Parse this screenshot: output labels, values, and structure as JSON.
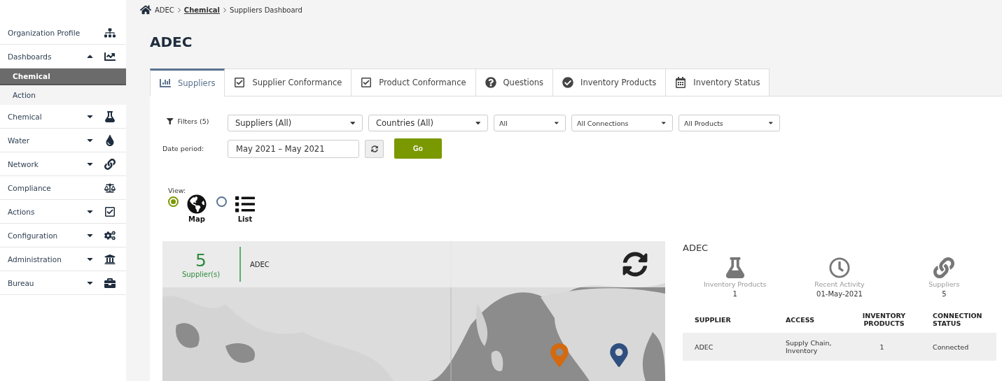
{
  "sidebar": {
    "items": [
      {
        "label": "Organization Profile",
        "kind": "link"
      },
      {
        "label": "Dashboards",
        "kind": "menu",
        "expanded": true,
        "children": [
          {
            "label": "Chemical",
            "selected": true
          },
          {
            "label": "Action",
            "selected": false
          }
        ]
      },
      {
        "label": "Chemical",
        "kind": "menu",
        "expanded": false
      },
      {
        "label": "Water",
        "kind": "menu",
        "expanded": false
      },
      {
        "label": "Network",
        "kind": "menu",
        "expanded": false
      },
      {
        "label": "Compliance",
        "kind": "link"
      },
      {
        "label": "Actions",
        "kind": "menu",
        "expanded": false
      },
      {
        "label": "Configuration",
        "kind": "menu",
        "expanded": false
      },
      {
        "label": "Administration",
        "kind": "menu",
        "expanded": false
      },
      {
        "label": "Bureau",
        "kind": "menu",
        "expanded": false
      }
    ]
  },
  "breadcrumb": [
    {
      "label": "ADEC",
      "kind": "text"
    },
    {
      "label": "Chemical",
      "kind": "link"
    },
    {
      "label": "Suppliers Dashboard",
      "kind": "text"
    }
  ],
  "page_title": "ADEC",
  "tabs": [
    {
      "label": "Suppliers",
      "selected": true
    },
    {
      "label": "Supplier Conformance",
      "selected": false
    },
    {
      "label": "Product Conformance",
      "selected": false
    },
    {
      "label": "Questions",
      "selected": false
    },
    {
      "label": "Inventory Products",
      "selected": false
    },
    {
      "label": "Inventory Status",
      "selected": false
    }
  ],
  "filters": {
    "label": "Filters (5)",
    "selects": [
      {
        "value": "Suppliers (All)",
        "kind": "large"
      },
      {
        "value": "Countries (All)",
        "kind": "large"
      },
      {
        "value": "All",
        "kind": "small"
      },
      {
        "value": "All Connections",
        "kind": "small"
      },
      {
        "value": "All Products",
        "kind": "small"
      }
    ]
  },
  "date_period": {
    "label": "Date period:",
    "value": "May 2021 – May 2021",
    "button": "Go"
  },
  "view": {
    "label": "View:",
    "options": [
      {
        "label": "Map",
        "selected": true
      },
      {
        "label": "List",
        "selected": false
      }
    ]
  },
  "map": {
    "count": "5",
    "count_label": "Supplier(s)",
    "name": "ADEC",
    "markers": [
      {
        "color": "#d4690f"
      },
      {
        "color": "#2f4f7f"
      }
    ]
  },
  "summary": {
    "title": "ADEC",
    "stats": [
      {
        "label": "Inventory Products",
        "value": "1"
      },
      {
        "label": "Recent Activity",
        "value": "01-May-2021"
      },
      {
        "label": "Suppliers",
        "value": "5"
      }
    ],
    "table": {
      "columns": [
        "SUPPLIER",
        "ACCESS",
        "INVENTORY PRODUCTS",
        "CONNECTION STATUS"
      ],
      "rows": [
        [
          "ADEC",
          "Supply Chain, Inventory",
          "1",
          "Connected"
        ]
      ]
    }
  }
}
